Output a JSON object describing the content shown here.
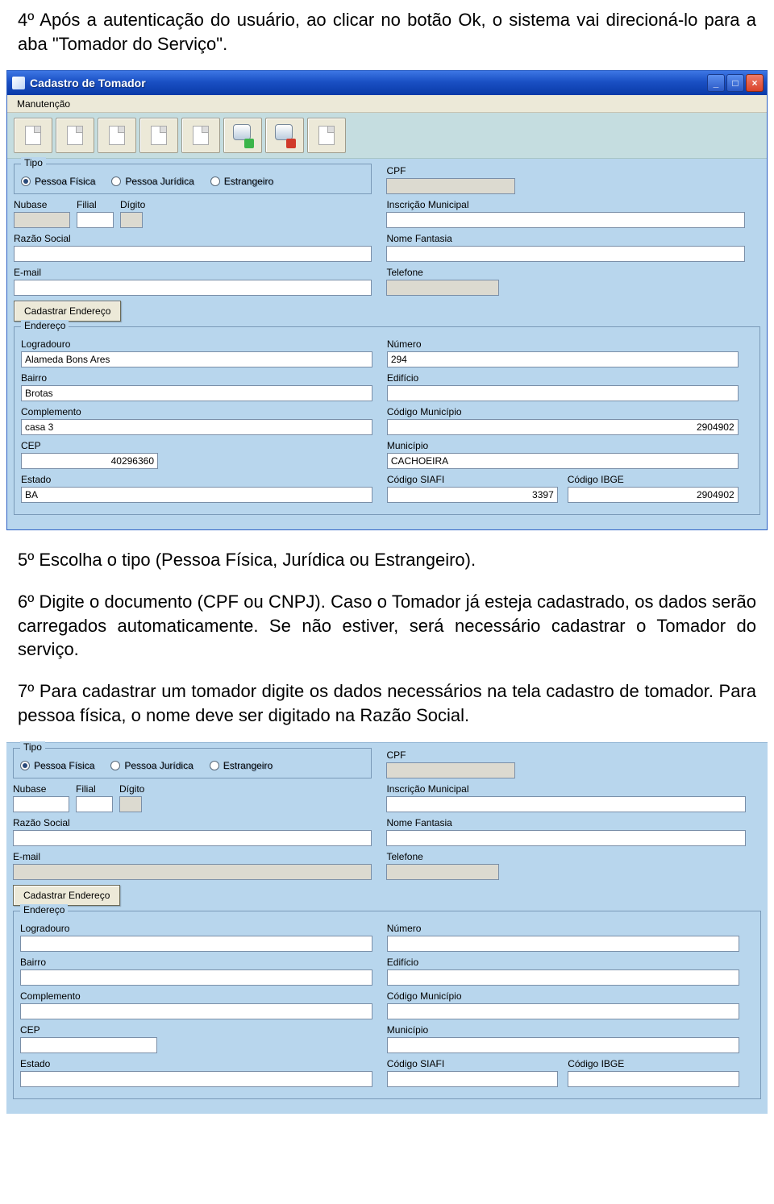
{
  "doc": {
    "p1": "4º Após a autenticação do usuário, ao clicar no botão Ok, o sistema vai direcioná-lo para a aba \"Tomador do Serviço\".",
    "p2": "5º Escolha o tipo (Pessoa Física, Jurídica ou Estrangeiro).",
    "p3": "6º Digite o documento (CPF ou CNPJ). Caso o Tomador já esteja cadastrado, os dados serão carregados automaticamente. Se não estiver, será necessário cadastrar o Tomador do serviço.",
    "p4": "7º Para cadastrar um tomador digite os dados necessários na tela cadastro de tomador. Para pessoa física, o nome deve ser digitado na Razão Social."
  },
  "window": {
    "title": "Cadastro de Tomador",
    "menu": {
      "manutencao": "Manutenção"
    },
    "tipo_group": "Tipo",
    "radios": {
      "pf": "Pessoa Física",
      "pj": "Pessoa Jurídica",
      "estr": "Estrangeiro"
    },
    "labels": {
      "cpf": "CPF",
      "nubase": "Nubase",
      "filial": "Filial",
      "digito": "Dígito",
      "inscricao": "Inscrição Municipal",
      "razao": "Razão Social",
      "fantasia": "Nome Fantasia",
      "email": "E-mail",
      "telefone": "Telefone",
      "cadastrar_endereco": "Cadastrar Endereço",
      "endereco": "Endereço",
      "logradouro": "Logradouro",
      "numero": "Número",
      "bairro": "Bairro",
      "edificio": "Edifício",
      "complemento": "Complemento",
      "cod_municipio": "Código Município",
      "cep": "CEP",
      "municipio": "Município",
      "estado": "Estado",
      "cod_siafi": "Código SIAFI",
      "cod_ibge": "Código IBGE"
    },
    "values": {
      "logradouro": "Alameda Bons Ares",
      "numero": "294",
      "bairro": "Brotas",
      "complemento": "casa 3",
      "cod_municipio": "2904902",
      "cep": "40296360",
      "municipio": "CACHOEIRA",
      "estado": "BA",
      "cod_siafi": "3397",
      "cod_ibge": "2904902"
    }
  }
}
